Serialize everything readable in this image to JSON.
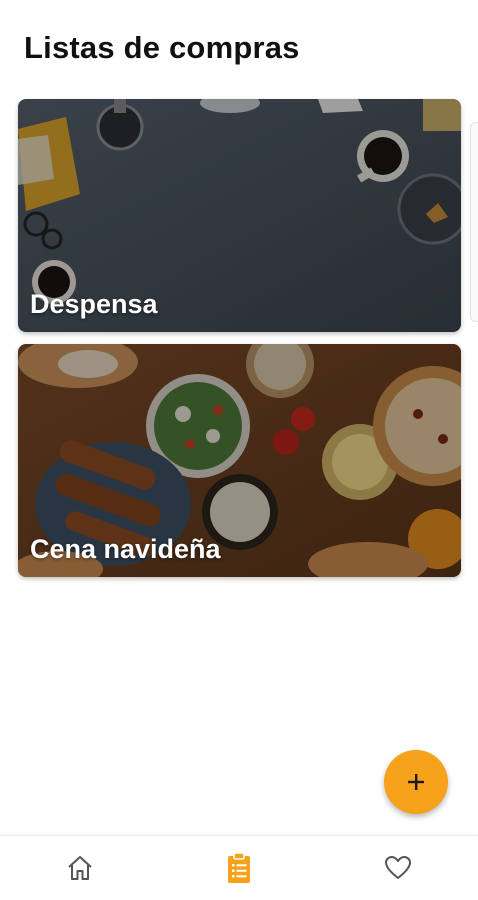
{
  "header": {
    "title": "Listas de compras"
  },
  "lists": [
    {
      "label": "Despensa"
    },
    {
      "label": "Cena navideña"
    }
  ],
  "fab": {
    "icon": "plus-icon"
  },
  "bottom_nav": {
    "items": [
      {
        "icon": "home-icon",
        "active": false
      },
      {
        "icon": "clipboard-list-icon",
        "active": true
      },
      {
        "icon": "heart-icon",
        "active": false
      }
    ]
  },
  "colors": {
    "accent": "#f7a21b",
    "inactive_icon": "#555555",
    "card_text": "#ffffff"
  }
}
